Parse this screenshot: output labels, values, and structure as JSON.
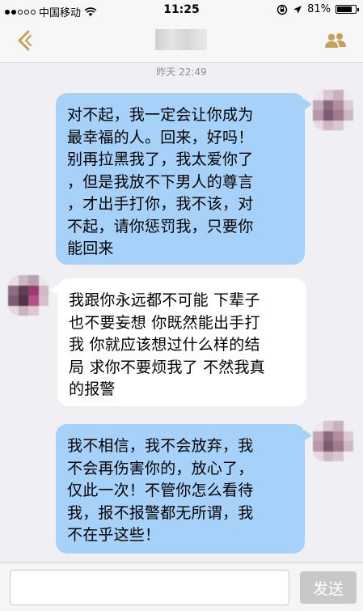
{
  "status_bar": {
    "carrier": "中国移动",
    "time": "11:25",
    "battery": "81%",
    "battery_level": 0.81
  },
  "nav": {
    "back_icon": "chevron-left-icon",
    "contact_icon": "contacts-icon",
    "accent_color": "#c8a05a"
  },
  "chat": {
    "timestamp": "昨天 22:49",
    "messages": [
      {
        "side": "out",
        "text": "对不起，我一定会让你成为\n最幸福的人。回来，好吗！\n别再拉黑我了，我太爱你了\n，但是我放不下男人的尊言\n，才出手打你，我不该，对\n不起，请你惩罚我，只要你\n能回来"
      },
      {
        "side": "in",
        "text": "我跟你永远都不可能 下辈子\n也不要妄想 你既然能出手打\n我 你就应该想过什么样的结\n局 求你不要烦我了 不然我真\n的报警"
      },
      {
        "side": "out",
        "text": "我不相信，我不会放弃，我\n不会再伤害你的，放心了，\n仅此一次！不管你怎么看待\n我，报不报警都无所谓，我\n不在乎这些！"
      }
    ]
  },
  "input_bar": {
    "value": "",
    "send_label": "发送"
  },
  "colors": {
    "outgoing_bubble": "#a6d2f9",
    "incoming_bubble": "#ffffff",
    "background": "#efeff4"
  }
}
